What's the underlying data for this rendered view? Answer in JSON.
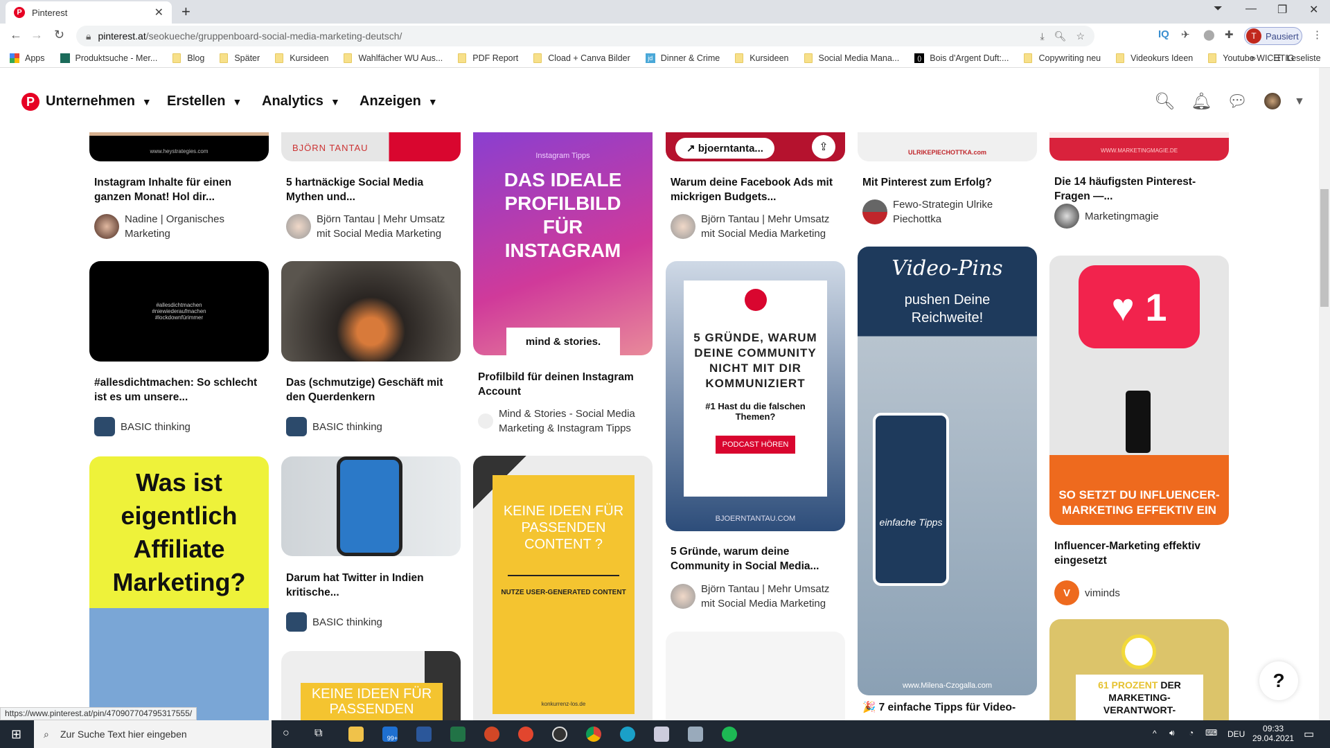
{
  "browser": {
    "tab_title": "Pinterest",
    "url_host": "pinterest.at",
    "url_path": "/seokueche/gruppenboard-social-media-marketing-deutsch/",
    "profile_label": "Pausiert",
    "profile_initial": "T",
    "reading_list": "Leseliste",
    "bookmarks": [
      "Apps",
      "Produktsuche - Mer...",
      "Blog",
      "Später",
      "Kursideen",
      "Wahlfächer WU Aus...",
      "PDF Report",
      "Cload + Canva Bilder",
      "Dinner & Crime",
      "Kursideen",
      "Social Media Mana...",
      "Bois d'Argent Duft:...",
      "Copywriting neu",
      "Videokurs Ideen",
      "Youtube WICHTIG"
    ],
    "more": "»"
  },
  "header": {
    "nav": [
      "Unternehmen",
      "Erstellen",
      "Analytics",
      "Anzeigen"
    ],
    "icons": [
      "search-icon",
      "bell-icon",
      "chat-icon",
      "avatar",
      "chevron-down-icon"
    ]
  },
  "pins": {
    "c1p1": {
      "title": "Instagram Inhalte für einen ganzen Monat! Hol dir...",
      "author": "Nadine | Organisches Marketing",
      "img": "www.heystrategies.com"
    },
    "c1p2": {
      "title": "#allesdichtmachen: So schlecht ist es um unsere...",
      "author": "BASIC thinking",
      "img": "#allesdichtmachen #niewiederaufmachen #lockdownfürimmer"
    },
    "c1p3": {
      "img": "Was ist eigentlich Affiliate Marketing?"
    },
    "c2p1": {
      "title": "5 hartnäckige Social Media Mythen und...",
      "author": "Björn Tantau | Mehr Umsatz mit Social Media Marketing",
      "img": "BJÖRN TANTAU"
    },
    "c2p2": {
      "title": "Das (schmutzige) Geschäft mit den Querdenkern",
      "author": "BASIC thinking"
    },
    "c2p3": {
      "title": "Darum hat Twitter in Indien kritische...",
      "author": "BASIC thinking"
    },
    "c2p4": {
      "img": "KEINE IDEEN FÜR PASSENDEN"
    },
    "c3p1": {
      "title": "Profilbild für deinen Instagram Account",
      "author": "Mind & Stories - Social Media Marketing & Instagram Tipps",
      "img_kicker": "Instagram Tipps",
      "img": "DAS IDEALE PROFILBILD FÜR INSTAGRAM",
      "img_brand": "mind & stories."
    },
    "c3p2": {
      "img": "KEINE IDEEN FÜR PASSENDEN CONTENT ?",
      "img_sub": "NUTZE USER-GENERATED CONTENT",
      "img_site": "konkurrenz-los.de"
    },
    "c4p1": {
      "title": "Warum deine Facebook Ads mit mickrigen Budgets...",
      "author": "Björn Tantau | Mehr Umsatz mit Social Media Marketing",
      "link_label": "bjoerntanta..."
    },
    "c4p2": {
      "title": "5 Gründe, warum deine Community in Social Media...",
      "author": "Björn Tantau | Mehr Umsatz mit Social Media Marketing",
      "img": "5 GRÜNDE, WARUM DEINE COMMUNITY NICHT MIT DIR KOMMUNIZIERT",
      "img_sub": "#1 Hast du die falschen Themen?",
      "img_button": "PODCAST HÖREN",
      "img_site": "BJOERNTANTAU.COM"
    },
    "c5p1": {
      "title": "Mit Pinterest zum Erfolg?",
      "author": "Fewo-Strategin Ulrike Piechottka",
      "img": "ULRIKEPIECHOTTKA.com"
    },
    "c5p2": {
      "title": "7 einfache Tipps für Video-",
      "img_script": "Video-Pins",
      "img": "pushen Deine Reichweite!",
      "img_tip": "einfache Tipps",
      "img_site": "www.Milena-Czogalla.com"
    },
    "c6p1": {
      "title": "Die 14 häufigsten Pinterest-Fragen —...",
      "author": "Marketingmagie",
      "img": "WWW.MARKETINGMAGIE.DE"
    },
    "c6p2": {
      "title": "Influencer-Marketing effektiv eingesetzt",
      "author": "viminds",
      "img_count": "1",
      "img": "SO SETZT DU INFLUENCER-MARKETING EFFEKTIV EIN"
    },
    "c6p3": {
      "img_hl": "61 PROZENT",
      "img": "DER MARKETING-VERANTWORT-"
    }
  },
  "help_label": "?",
  "status_url": "https://www.pinterest.at/pin/470907704795317555/",
  "taskbar": {
    "search_placeholder": "Zur Suche Text hier eingeben",
    "mail_badge": "99+",
    "lang": "DEU",
    "time": "09:33",
    "date": "29.04.2021"
  },
  "colors": {
    "brand": "#e60023",
    "taskbar": "#1f2833"
  }
}
